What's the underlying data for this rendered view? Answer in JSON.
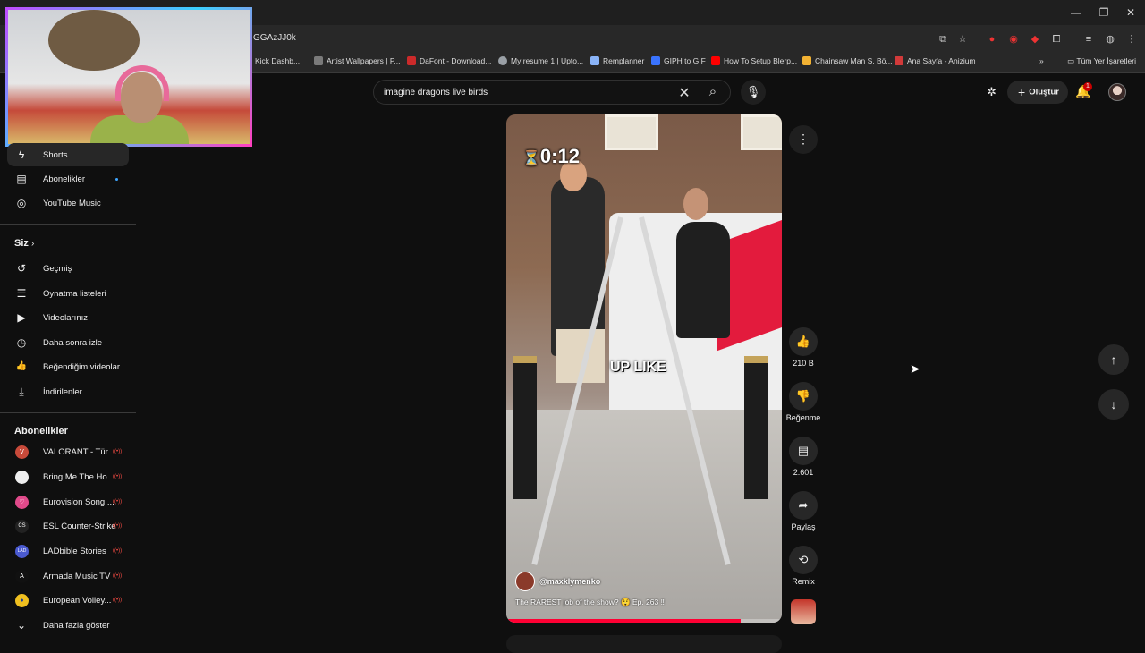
{
  "browser": {
    "url": "GGAzJJ0k",
    "window_controls": [
      "—",
      "❐",
      "✕"
    ],
    "bookmarks": [
      {
        "label": "Kick Dashb...",
        "color": "#53fc18"
      },
      {
        "label": "Artist Wallpapers | P...",
        "color": "#7a7a7a"
      },
      {
        "label": "DaFont - Download...",
        "color": "#cc2a2a"
      },
      {
        "label": "My resume 1 | Upto...",
        "color": "#9aa0a6"
      },
      {
        "label": "Remplanner",
        "color": "#8ab4f8"
      },
      {
        "label": "GIPH to GIF",
        "color": "#3a74ff"
      },
      {
        "label": "How To Setup Blerp...",
        "color": "#ff0000"
      },
      {
        "label": "Chainsaw Man S. Bö...",
        "color": "#f2b233"
      },
      {
        "label": "Ana Sayfa - Anizium",
        "color": "#d23a3a"
      }
    ],
    "all_bookmarks": "Tüm Yer İşaretleri"
  },
  "header": {
    "search_value": "imagine dragons live birds",
    "create_label": "Oluştur",
    "notification_count": "1"
  },
  "sidebar": {
    "top_items": [
      {
        "label": "Shorts",
        "icon": "shorts-icon",
        "glyph": "ϟ",
        "active": true
      },
      {
        "label": "Abonelikler",
        "icon": "subscriptions-icon",
        "glyph": "▤",
        "dot": true
      },
      {
        "label": "YouTube Music",
        "icon": "music-icon",
        "glyph": "◎"
      }
    ],
    "you_heading": "Siz",
    "you_items": [
      {
        "label": "Geçmiş",
        "icon": "history-icon",
        "glyph": "↺"
      },
      {
        "label": "Oynatma listeleri",
        "icon": "playlists-icon",
        "glyph": "☰"
      },
      {
        "label": "Videolarınız",
        "icon": "your-videos-icon",
        "glyph": "▶"
      },
      {
        "label": "Daha sonra izle",
        "icon": "watch-later-icon",
        "glyph": "◷"
      },
      {
        "label": "Beğendiğim videolar",
        "icon": "liked-videos-icon",
        "glyph": "👍"
      },
      {
        "label": "İndirilenler",
        "icon": "downloads-icon",
        "glyph": "⤓"
      }
    ],
    "subs_heading": "Abonelikler",
    "subscriptions": [
      {
        "label": "VALORANT - Tür...",
        "color": "#c84a3a",
        "glyph": "V"
      },
      {
        "label": "Bring Me The Ho...",
        "color": "#eeeeee",
        "glyph": ""
      },
      {
        "label": "Eurovision Song ...",
        "color": "#e04a8a",
        "glyph": "♡"
      },
      {
        "label": "ESL Counter-Strike",
        "color": "#222222",
        "glyph": "CS"
      },
      {
        "label": "LADbible Stories",
        "color": "#4a5ad0",
        "glyph": "LAD"
      },
      {
        "label": "Armada Music TV",
        "color": "#111111",
        "glyph": "A"
      },
      {
        "label": "European Volley...",
        "color": "#f0c020",
        "glyph": "●"
      }
    ],
    "show_more": "Daha fazla göster"
  },
  "short": {
    "timer": "0:12",
    "caption": "UP LIKE",
    "channel": "@maxklymenko",
    "title": "The RAREST job of the show? 😲 Ep. 263 ‼",
    "progress": 0.85
  },
  "actions": {
    "likes": "210 B",
    "dislike": "Beğenme",
    "comments": "2.601",
    "share": "Paylaş",
    "remix": "Remix"
  }
}
